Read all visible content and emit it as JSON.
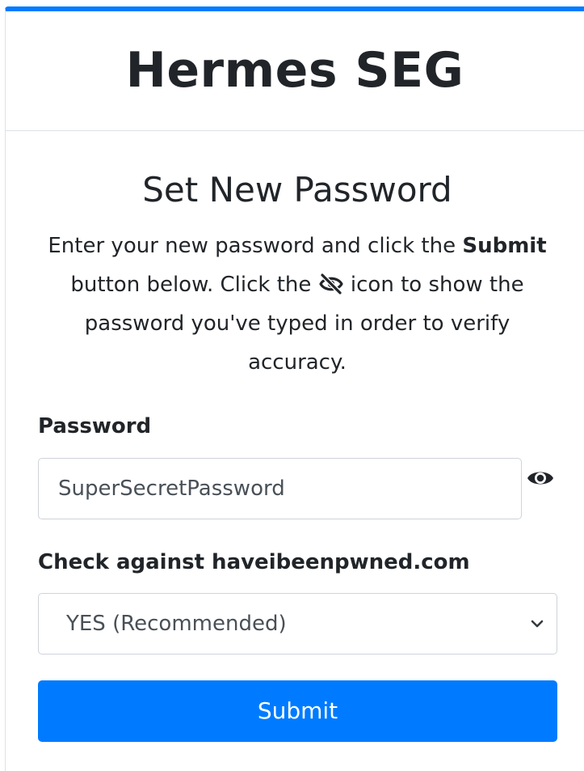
{
  "header": {
    "brand": "Hermes SEG"
  },
  "main": {
    "title": "Set New Password",
    "instructions": {
      "part1": "Enter your new password and click the ",
      "bold": "Submit",
      "part2": " button below. Click the ",
      "part3": " icon to show the password you've typed in order to verify accuracy."
    },
    "password": {
      "label": "Password",
      "value": "SuperSecretPassword"
    },
    "check": {
      "label": "Check against haveibeenpwned.com",
      "selected": "YES (Recommended)"
    },
    "submit_label": "Submit"
  },
  "colors": {
    "accent": "#007bff",
    "text": "#212529",
    "border": "#ced4da"
  },
  "icons": {
    "inline": "eye-slash-icon",
    "toggle": "eye-icon",
    "select": "chevron-down-icon"
  }
}
